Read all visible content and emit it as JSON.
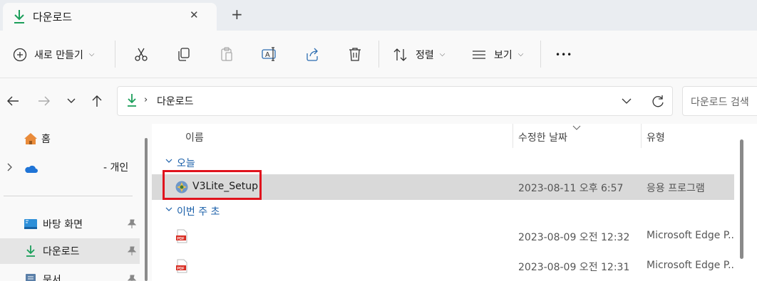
{
  "tab": {
    "label": "다운로드",
    "icon": "download-icon",
    "close_glyph": "✕",
    "new_glyph": "+"
  },
  "toolbar": {
    "new_label": "새로 만들기",
    "sort_label": "정렬",
    "view_label": "보기",
    "more_glyph": "•••",
    "icons": [
      "plus-circle-icon",
      "cut-icon",
      "copy-icon",
      "paste-icon",
      "rename-icon",
      "share-icon",
      "delete-icon",
      "sort-icon",
      "view-icon",
      "more-icon"
    ]
  },
  "address": {
    "path_label": "다운로드",
    "separator": "›"
  },
  "search": {
    "placeholder": "다운로드 검색"
  },
  "sidebar": {
    "items": [
      {
        "label": "홈",
        "icon": "home-icon"
      },
      {
        "label": "- 개인",
        "icon": "onedrive-icon"
      },
      {
        "label": "바탕 화면",
        "icon": "desktop-icon"
      },
      {
        "label": "다운로드",
        "icon": "download-icon"
      },
      {
        "label": "문서",
        "icon": "documents-icon"
      }
    ]
  },
  "columns": {
    "name": "이름",
    "date": "수정한 날짜",
    "type": "유형"
  },
  "groups": [
    {
      "label": "오늘",
      "files": [
        {
          "name": "V3Lite_Setup",
          "date": "2023-08-11 오후 6:57",
          "type": "응용 프로그램",
          "icon": "installer-icon"
        }
      ]
    },
    {
      "label": "이번 주 초",
      "files": [
        {
          "name": "",
          "date": "2023-08-09 오전 12:32",
          "type": "Microsoft Edge P...",
          "icon": "pdf-icon"
        },
        {
          "name": "",
          "date": "2023-08-09 오전 12:31",
          "type": "Microsoft Edge P...",
          "icon": "pdf-icon"
        }
      ]
    }
  ],
  "colors": {
    "accent": "#e0141e",
    "download_green": "#1b9e5a",
    "group_blue": "#1a5fa9"
  }
}
